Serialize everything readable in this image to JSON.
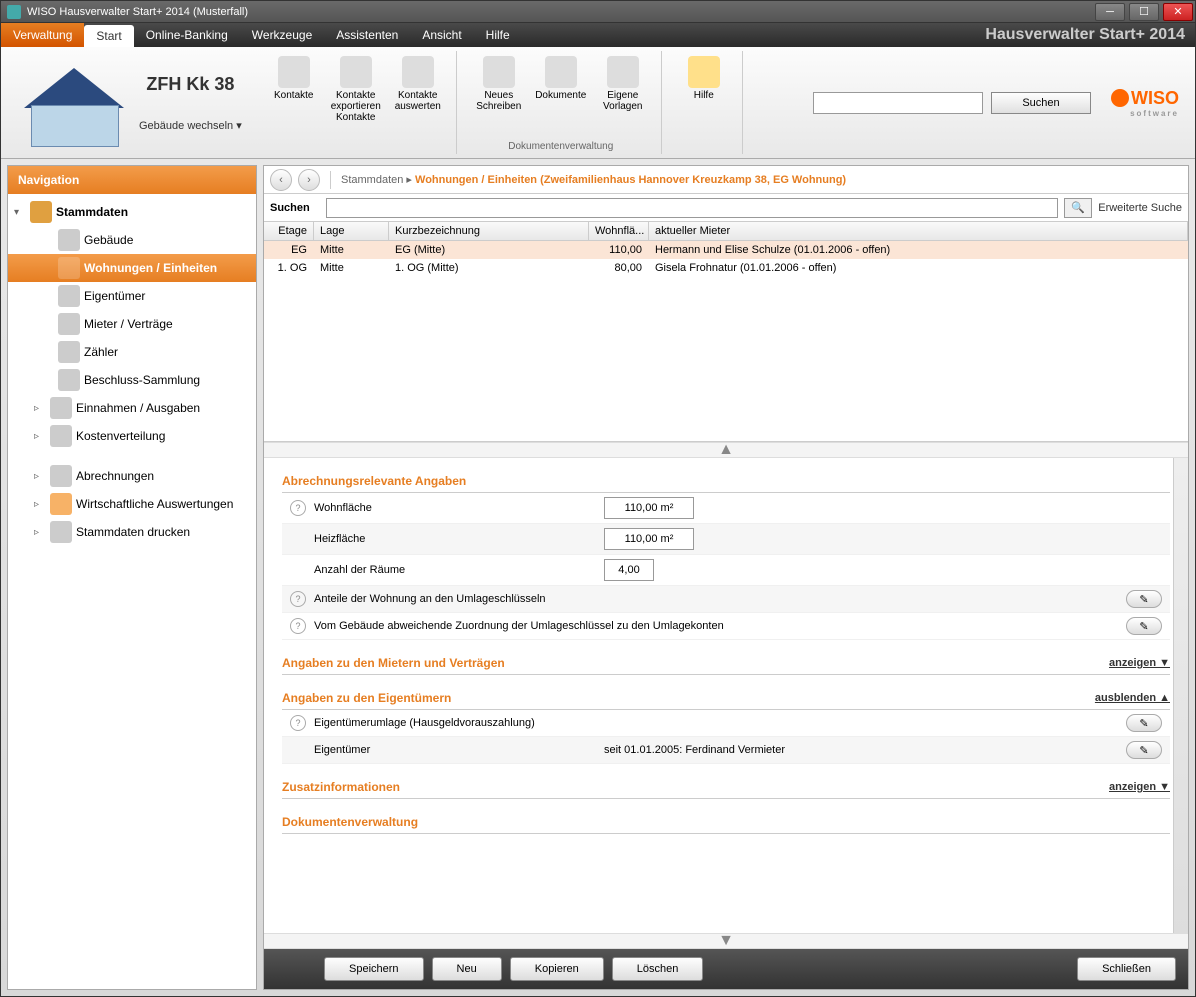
{
  "window": {
    "title": "WISO Hausverwalter Start+ 2014 (Musterfall)"
  },
  "menubar": {
    "verwaltung": "Verwaltung",
    "start": "Start",
    "online": "Online-Banking",
    "werkzeuge": "Werkzeuge",
    "assistenten": "Assistenten",
    "ansicht": "Ansicht",
    "hilfe": "Hilfe",
    "brand": "Hausverwalter Start+ 2014"
  },
  "ribbon": {
    "house_title": "ZFH Kk 38",
    "house_sub": "Gebäude wechseln ▾",
    "kontakte": "Kontakte",
    "kexport": "Kontakte exportieren Kontakte",
    "kauswerten": "Kontakte auswerten",
    "neues": "Neues Schreiben",
    "dokumente": "Dokumente",
    "vorlagen": "Eigene Vorlagen",
    "hilfe": "Hilfe",
    "group_dok": "Dokumentenverwaltung",
    "search_btn": "Suchen",
    "logo": "WISO",
    "logo_sub": "software"
  },
  "nav": {
    "header": "Navigation",
    "stammdaten": "Stammdaten",
    "gebaeude": "Gebäude",
    "wohnungen": "Wohnungen / Einheiten",
    "eigentuemer": "Eigentümer",
    "mieter": "Mieter / Verträge",
    "zaehler": "Zähler",
    "beschluss": "Beschluss-Sammlung",
    "einnahmen": "Einnahmen / Ausgaben",
    "kosten": "Kostenverteilung",
    "abrechnungen": "Abrechnungen",
    "auswert": "Wirtschaftliche Auswertungen",
    "drucken": "Stammdaten drucken"
  },
  "crumb": {
    "root": "Stammdaten",
    "path": "Wohnungen / Einheiten (Zweifamilienhaus Hannover Kreuzkamp 38, EG Wohnung)"
  },
  "search": {
    "label": "Suchen",
    "adv": "Erweiterte Suche"
  },
  "grid": {
    "h_etage": "Etage",
    "h_lage": "Lage",
    "h_kurz": "Kurzbezeichnung",
    "h_wfl": "Wohnflä...",
    "h_mieter": "aktueller Mieter",
    "rows": [
      {
        "etage": "EG",
        "lage": "Mitte",
        "kurz": "EG (Mitte)",
        "wfl": "110,00",
        "mieter": "Hermann und Elise Schulze (01.01.2006 - offen)"
      },
      {
        "etage": "1. OG",
        "lage": "Mitte",
        "kurz": "1. OG (Mitte)",
        "wfl": "80,00",
        "mieter": "Gisela Frohnatur (01.01.2006 - offen)"
      }
    ]
  },
  "sections": {
    "abrechnung": "Abrechnungsrelevante Angaben",
    "wohnflaeche_lbl": "Wohnfläche",
    "wohnflaeche_val": "110,00 m²",
    "heizflaeche_lbl": "Heizfläche",
    "heizflaeche_val": "110,00 m²",
    "raeume_lbl": "Anzahl der Räume",
    "raeume_val": "4,00",
    "anteile": "Anteile der Wohnung an den Umlageschlüsseln",
    "abweich": "Vom Gebäude abweichende Zuordnung der Umlageschlüssel zu den Umlagekonten",
    "mieter_sect": "Angaben zu den Mietern und Verträgen",
    "anzeigen": "anzeigen ▼",
    "eigent_sect": "Angaben zu den Eigentümern",
    "ausblenden": "ausblenden ▲",
    "eig_umlage": "Eigentümerumlage (Hausgeldvorauszahlung)",
    "eig_lbl": "Eigentümer",
    "eig_val": "seit 01.01.2005: Ferdinand Vermieter",
    "zusatz": "Zusatzinformationen",
    "dokverw": "Dokumentenverwaltung"
  },
  "footer": {
    "speichern": "Speichern",
    "neu": "Neu",
    "kopieren": "Kopieren",
    "loeschen": "Löschen",
    "schliessen": "Schließen"
  }
}
